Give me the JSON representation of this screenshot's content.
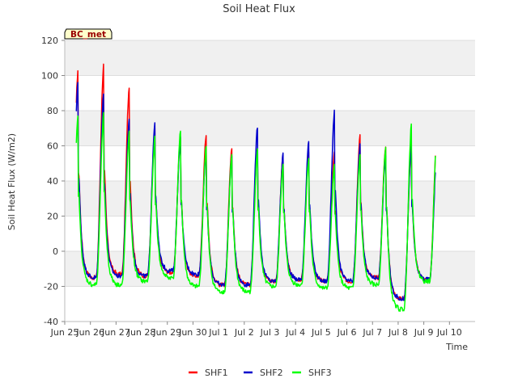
{
  "chart_data": {
    "type": "line",
    "title": "Soil Heat Flux",
    "xlabel": "Time",
    "ylabel": "Soil Heat Flux (W/m2)",
    "ylim": [
      -40,
      120
    ],
    "xlim_days": [
      0,
      16
    ],
    "yticks": [
      -40,
      -20,
      0,
      20,
      40,
      60,
      80,
      100,
      120
    ],
    "xticks": [
      "Jun 25",
      "Jun 26",
      "Jun 27",
      "Jun 28",
      "Jun 29",
      "Jun 30",
      "Jul 1",
      "Jul 2",
      "Jul 3",
      "Jul 4",
      "Jul 5",
      "Jul 6",
      "Jul 7",
      "Jul 8",
      "Jul 9",
      "Jul 10"
    ],
    "grid": true,
    "annotation": "BC_met",
    "legend_position": "bottom",
    "series": [
      {
        "name": "SHF1",
        "color": "#ff0000",
        "peaks": [
          104,
          107,
          95,
          70,
          66,
          67,
          60,
          60,
          56,
          56,
          56,
          66,
          60,
          62,
          68
        ],
        "troughs": [
          -17,
          -15,
          -13,
          -14,
          -12,
          -14,
          -19,
          -19,
          -17,
          -16,
          -17,
          -17,
          -15,
          -27,
          -16
        ]
      },
      {
        "name": "SHF2",
        "color": "#0000cc",
        "peaks": [
          98,
          91,
          76,
          74,
          65,
          57,
          55,
          72,
          56,
          64,
          80,
          61,
          55,
          61,
          58
        ],
        "troughs": [
          -16,
          -15,
          -14,
          -14,
          -11,
          -13,
          -19,
          -19,
          -17,
          -16,
          -17,
          -17,
          -15,
          -27,
          -16
        ]
      },
      {
        "name": "SHF3",
        "color": "#00ff00",
        "peaks": [
          77,
          79,
          68,
          65,
          69,
          61,
          55,
          58,
          51,
          54,
          49,
          55,
          60,
          73,
          68
        ],
        "troughs": [
          -20,
          -19,
          -19,
          -17,
          -15,
          -20,
          -23,
          -23,
          -20,
          -19,
          -21,
          -21,
          -19,
          -33,
          -17
        ]
      }
    ]
  }
}
